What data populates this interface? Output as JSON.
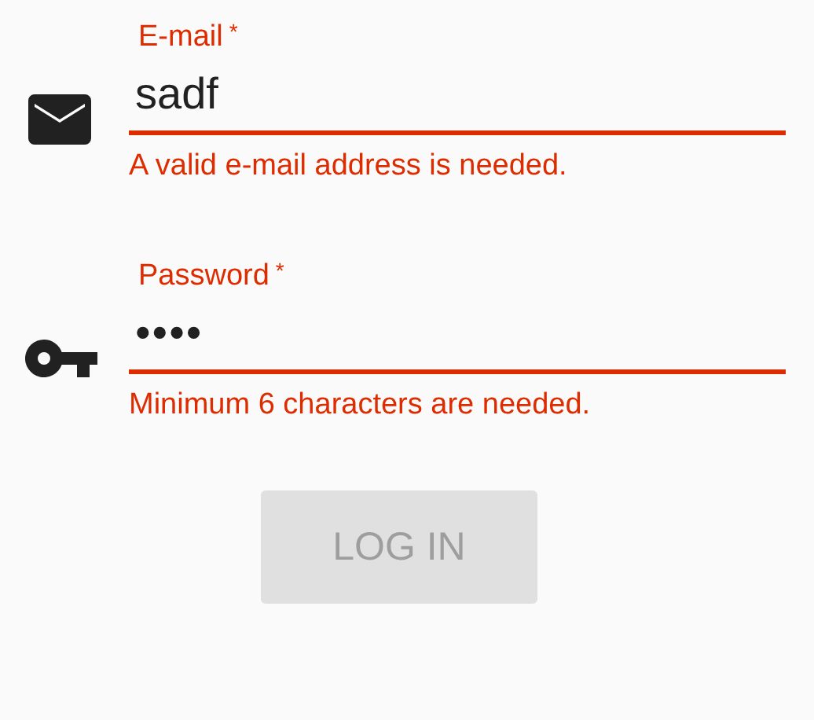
{
  "fields": [
    {
      "kind": "email",
      "label": "E-mail",
      "required_mark": "*",
      "value": "sadf",
      "invalid": true,
      "error": "A valid e-mail address is needed."
    },
    {
      "kind": "password",
      "label": "Password",
      "required_mark": "*",
      "value": "••••",
      "invalid": true,
      "error": "Minimum 6 characters are needed."
    }
  ],
  "button": {
    "label": "LOG IN",
    "disabled": true
  }
}
